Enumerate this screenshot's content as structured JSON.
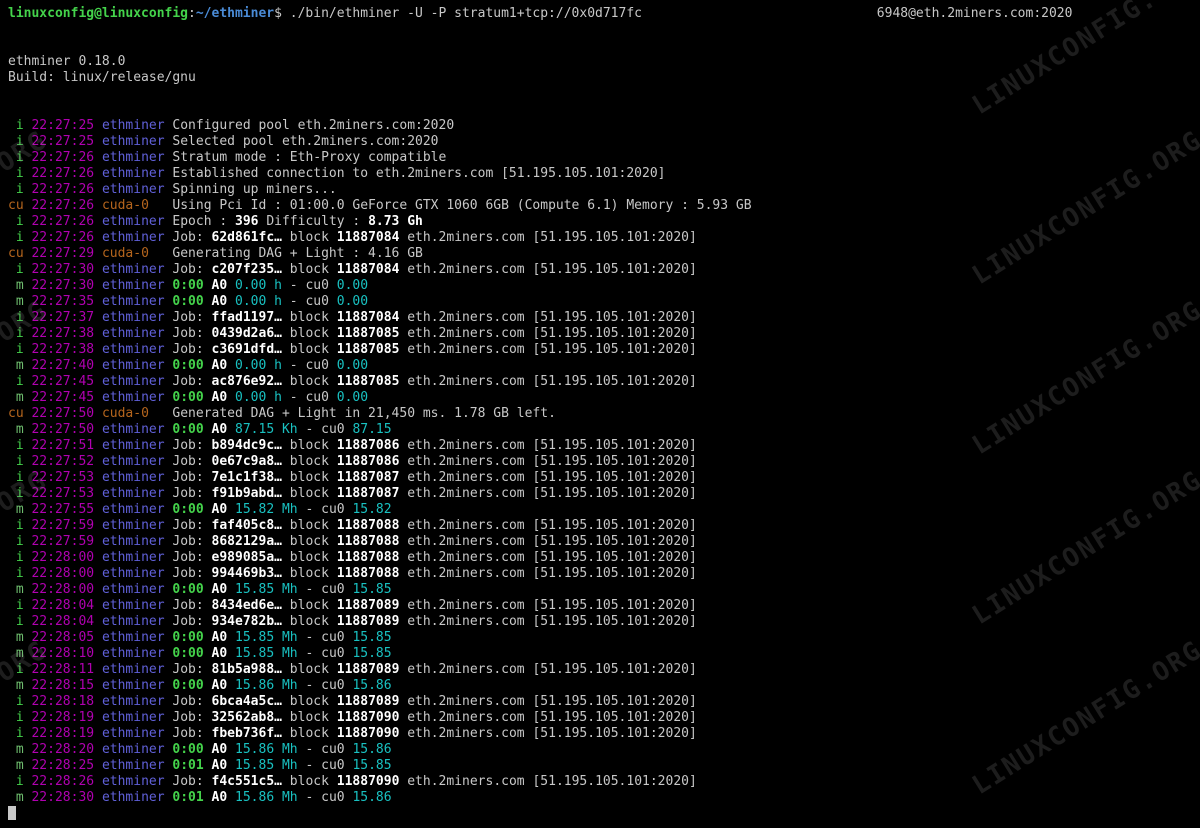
{
  "prompt": {
    "user": "linuxconfig@linuxconfig",
    "path": "~/ethminer",
    "command": "./bin/ethminer -U -P stratum1+tcp://0x0d717fc",
    "command_tail": "6948@eth.2miners.com:2020"
  },
  "header": {
    "line1": "ethminer 0.18.0",
    "line2": "Build: linux/release/gnu"
  },
  "watermark": "LINUXCONFIG.ORG",
  "lines": [
    {
      "tag": " i",
      "ts": "22:27:25",
      "cp": "ethminer",
      "k": "eth",
      "msg": [
        [
          "w",
          "Configured pool eth.2miners.com:2020"
        ]
      ]
    },
    {
      "tag": " i",
      "ts": "22:27:25",
      "cp": "ethminer",
      "k": "eth",
      "msg": [
        [
          "w",
          "Selected pool eth.2miners.com:2020"
        ]
      ]
    },
    {
      "tag": " i",
      "ts": "22:27:26",
      "cp": "ethminer",
      "k": "eth",
      "msg": [
        [
          "w",
          "Stratum mode : Eth-Proxy compatible"
        ]
      ]
    },
    {
      "tag": " i",
      "ts": "22:27:26",
      "cp": "ethminer",
      "k": "eth",
      "msg": [
        [
          "w",
          "Established connection to eth.2miners.com [51.195.105.101:2020]"
        ]
      ]
    },
    {
      "tag": " i",
      "ts": "22:27:26",
      "cp": "ethminer",
      "k": "eth",
      "msg": [
        [
          "w",
          "Spinning up miners..."
        ]
      ]
    },
    {
      "tag": "cu",
      "ts": "22:27:26",
      "cp": "cuda-0  ",
      "k": "cud",
      "msg": [
        [
          "w",
          "Using Pci Id : 01:00.0 GeForce GTX 1060 6GB (Compute 6.1) Memory : 5.93 GB"
        ]
      ]
    },
    {
      "tag": " i",
      "ts": "22:27:26",
      "cp": "ethminer",
      "k": "eth",
      "msg": [
        [
          "w",
          "Epoch : "
        ],
        [
          "bw",
          "396"
        ],
        [
          "w",
          " Difficulty : "
        ],
        [
          "bw",
          "8.73 Gh"
        ]
      ]
    },
    {
      "tag": " i",
      "ts": "22:27:26",
      "cp": "ethminer",
      "k": "eth",
      "msg": [
        [
          "w",
          "Job: "
        ],
        [
          "bw",
          "62d861fc…"
        ],
        [
          "w",
          " block "
        ],
        [
          "bw",
          "11887084"
        ],
        [
          "w",
          " eth.2miners.com [51.195.105.101:2020]"
        ]
      ]
    },
    {
      "tag": "cu",
      "ts": "22:27:29",
      "cp": "cuda-0  ",
      "k": "cud",
      "msg": [
        [
          "w",
          "Generating DAG + Light : 4.16 GB"
        ]
      ]
    },
    {
      "tag": " i",
      "ts": "22:27:30",
      "cp": "ethminer",
      "k": "eth",
      "msg": [
        [
          "w",
          "Job: "
        ],
        [
          "bw",
          "c207f235…"
        ],
        [
          "w",
          " block "
        ],
        [
          "bw",
          "11887084"
        ],
        [
          "w",
          " eth.2miners.com [51.195.105.101:2020]"
        ]
      ]
    },
    {
      "tag": " m",
      "ts": "22:27:30",
      "cp": "ethminer",
      "k": "eth",
      "msg": [
        [
          "bg",
          "0:00"
        ],
        [
          "w",
          " "
        ],
        [
          "bw",
          "A0"
        ],
        [
          "w",
          " "
        ],
        [
          "cy",
          "0.00 h"
        ],
        [
          "w",
          " - cu0 "
        ],
        [
          "cy",
          "0.00"
        ]
      ]
    },
    {
      "tag": " m",
      "ts": "22:27:35",
      "cp": "ethminer",
      "k": "eth",
      "msg": [
        [
          "bg",
          "0:00"
        ],
        [
          "w",
          " "
        ],
        [
          "bw",
          "A0"
        ],
        [
          "w",
          " "
        ],
        [
          "cy",
          "0.00 h"
        ],
        [
          "w",
          " - cu0 "
        ],
        [
          "cy",
          "0.00"
        ]
      ]
    },
    {
      "tag": " i",
      "ts": "22:27:37",
      "cp": "ethminer",
      "k": "eth",
      "msg": [
        [
          "w",
          "Job: "
        ],
        [
          "bw",
          "ffad1197…"
        ],
        [
          "w",
          " block "
        ],
        [
          "bw",
          "11887084"
        ],
        [
          "w",
          " eth.2miners.com [51.195.105.101:2020]"
        ]
      ]
    },
    {
      "tag": " i",
      "ts": "22:27:38",
      "cp": "ethminer",
      "k": "eth",
      "msg": [
        [
          "w",
          "Job: "
        ],
        [
          "bw",
          "0439d2a6…"
        ],
        [
          "w",
          " block "
        ],
        [
          "bw",
          "11887085"
        ],
        [
          "w",
          " eth.2miners.com [51.195.105.101:2020]"
        ]
      ]
    },
    {
      "tag": " i",
      "ts": "22:27:38",
      "cp": "ethminer",
      "k": "eth",
      "msg": [
        [
          "w",
          "Job: "
        ],
        [
          "bw",
          "c3691dfd…"
        ],
        [
          "w",
          " block "
        ],
        [
          "bw",
          "11887085"
        ],
        [
          "w",
          " eth.2miners.com [51.195.105.101:2020]"
        ]
      ]
    },
    {
      "tag": " m",
      "ts": "22:27:40",
      "cp": "ethminer",
      "k": "eth",
      "msg": [
        [
          "bg",
          "0:00"
        ],
        [
          "w",
          " "
        ],
        [
          "bw",
          "A0"
        ],
        [
          "w",
          " "
        ],
        [
          "cy",
          "0.00 h"
        ],
        [
          "w",
          " - cu0 "
        ],
        [
          "cy",
          "0.00"
        ]
      ]
    },
    {
      "tag": " i",
      "ts": "22:27:45",
      "cp": "ethminer",
      "k": "eth",
      "msg": [
        [
          "w",
          "Job: "
        ],
        [
          "bw",
          "ac876e92…"
        ],
        [
          "w",
          " block "
        ],
        [
          "bw",
          "11887085"
        ],
        [
          "w",
          " eth.2miners.com [51.195.105.101:2020]"
        ]
      ]
    },
    {
      "tag": " m",
      "ts": "22:27:45",
      "cp": "ethminer",
      "k": "eth",
      "msg": [
        [
          "bg",
          "0:00"
        ],
        [
          "w",
          " "
        ],
        [
          "bw",
          "A0"
        ],
        [
          "w",
          " "
        ],
        [
          "cy",
          "0.00 h"
        ],
        [
          "w",
          " - cu0 "
        ],
        [
          "cy",
          "0.00"
        ]
      ]
    },
    {
      "tag": "cu",
      "ts": "22:27:50",
      "cp": "cuda-0  ",
      "k": "cud",
      "msg": [
        [
          "w",
          "Generated DAG + Light in 21,450 ms. 1.78 GB left."
        ]
      ]
    },
    {
      "tag": " m",
      "ts": "22:27:50",
      "cp": "ethminer",
      "k": "eth",
      "msg": [
        [
          "bg",
          "0:00"
        ],
        [
          "w",
          " "
        ],
        [
          "bw",
          "A0"
        ],
        [
          "w",
          " "
        ],
        [
          "cy",
          "87.15 Kh"
        ],
        [
          "w",
          " - cu0 "
        ],
        [
          "cy",
          "87.15"
        ]
      ]
    },
    {
      "tag": " i",
      "ts": "22:27:51",
      "cp": "ethminer",
      "k": "eth",
      "msg": [
        [
          "w",
          "Job: "
        ],
        [
          "bw",
          "b894dc9c…"
        ],
        [
          "w",
          " block "
        ],
        [
          "bw",
          "11887086"
        ],
        [
          "w",
          " eth.2miners.com [51.195.105.101:2020]"
        ]
      ]
    },
    {
      "tag": " i",
      "ts": "22:27:52",
      "cp": "ethminer",
      "k": "eth",
      "msg": [
        [
          "w",
          "Job: "
        ],
        [
          "bw",
          "0e67c9a8…"
        ],
        [
          "w",
          " block "
        ],
        [
          "bw",
          "11887086"
        ],
        [
          "w",
          " eth.2miners.com [51.195.105.101:2020]"
        ]
      ]
    },
    {
      "tag": " i",
      "ts": "22:27:53",
      "cp": "ethminer",
      "k": "eth",
      "msg": [
        [
          "w",
          "Job: "
        ],
        [
          "bw",
          "7e1c1f38…"
        ],
        [
          "w",
          " block "
        ],
        [
          "bw",
          "11887087"
        ],
        [
          "w",
          " eth.2miners.com [51.195.105.101:2020]"
        ]
      ]
    },
    {
      "tag": " i",
      "ts": "22:27:53",
      "cp": "ethminer",
      "k": "eth",
      "msg": [
        [
          "w",
          "Job: "
        ],
        [
          "bw",
          "f91b9abd…"
        ],
        [
          "w",
          " block "
        ],
        [
          "bw",
          "11887087"
        ],
        [
          "w",
          " eth.2miners.com [51.195.105.101:2020]"
        ]
      ]
    },
    {
      "tag": " m",
      "ts": "22:27:55",
      "cp": "ethminer",
      "k": "eth",
      "msg": [
        [
          "bg",
          "0:00"
        ],
        [
          "w",
          " "
        ],
        [
          "bw",
          "A0"
        ],
        [
          "w",
          " "
        ],
        [
          "cy",
          "15.82 Mh"
        ],
        [
          "w",
          " - cu0 "
        ],
        [
          "cy",
          "15.82"
        ]
      ]
    },
    {
      "tag": " i",
      "ts": "22:27:59",
      "cp": "ethminer",
      "k": "eth",
      "msg": [
        [
          "w",
          "Job: "
        ],
        [
          "bw",
          "faf405c8…"
        ],
        [
          "w",
          " block "
        ],
        [
          "bw",
          "11887088"
        ],
        [
          "w",
          " eth.2miners.com [51.195.105.101:2020]"
        ]
      ]
    },
    {
      "tag": " i",
      "ts": "22:27:59",
      "cp": "ethminer",
      "k": "eth",
      "msg": [
        [
          "w",
          "Job: "
        ],
        [
          "bw",
          "8682129a…"
        ],
        [
          "w",
          " block "
        ],
        [
          "bw",
          "11887088"
        ],
        [
          "w",
          " eth.2miners.com [51.195.105.101:2020]"
        ]
      ]
    },
    {
      "tag": " i",
      "ts": "22:28:00",
      "cp": "ethminer",
      "k": "eth",
      "msg": [
        [
          "w",
          "Job: "
        ],
        [
          "bw",
          "e989085a…"
        ],
        [
          "w",
          " block "
        ],
        [
          "bw",
          "11887088"
        ],
        [
          "w",
          " eth.2miners.com [51.195.105.101:2020]"
        ]
      ]
    },
    {
      "tag": " i",
      "ts": "22:28:00",
      "cp": "ethminer",
      "k": "eth",
      "msg": [
        [
          "w",
          "Job: "
        ],
        [
          "bw",
          "994469b3…"
        ],
        [
          "w",
          " block "
        ],
        [
          "bw",
          "11887088"
        ],
        [
          "w",
          " eth.2miners.com [51.195.105.101:2020]"
        ]
      ]
    },
    {
      "tag": " m",
      "ts": "22:28:00",
      "cp": "ethminer",
      "k": "eth",
      "msg": [
        [
          "bg",
          "0:00"
        ],
        [
          "w",
          " "
        ],
        [
          "bw",
          "A0"
        ],
        [
          "w",
          " "
        ],
        [
          "cy",
          "15.85 Mh"
        ],
        [
          "w",
          " - cu0 "
        ],
        [
          "cy",
          "15.85"
        ]
      ]
    },
    {
      "tag": " i",
      "ts": "22:28:04",
      "cp": "ethminer",
      "k": "eth",
      "msg": [
        [
          "w",
          "Job: "
        ],
        [
          "bw",
          "8434ed6e…"
        ],
        [
          "w",
          " block "
        ],
        [
          "bw",
          "11887089"
        ],
        [
          "w",
          " eth.2miners.com [51.195.105.101:2020]"
        ]
      ]
    },
    {
      "tag": " i",
      "ts": "22:28:04",
      "cp": "ethminer",
      "k": "eth",
      "msg": [
        [
          "w",
          "Job: "
        ],
        [
          "bw",
          "934e782b…"
        ],
        [
          "w",
          " block "
        ],
        [
          "bw",
          "11887089"
        ],
        [
          "w",
          " eth.2miners.com [51.195.105.101:2020]"
        ]
      ]
    },
    {
      "tag": " m",
      "ts": "22:28:05",
      "cp": "ethminer",
      "k": "eth",
      "msg": [
        [
          "bg",
          "0:00"
        ],
        [
          "w",
          " "
        ],
        [
          "bw",
          "A0"
        ],
        [
          "w",
          " "
        ],
        [
          "cy",
          "15.85 Mh"
        ],
        [
          "w",
          " - cu0 "
        ],
        [
          "cy",
          "15.85"
        ]
      ]
    },
    {
      "tag": " m",
      "ts": "22:28:10",
      "cp": "ethminer",
      "k": "eth",
      "msg": [
        [
          "bg",
          "0:00"
        ],
        [
          "w",
          " "
        ],
        [
          "bw",
          "A0"
        ],
        [
          "w",
          " "
        ],
        [
          "cy",
          "15.85 Mh"
        ],
        [
          "w",
          " - cu0 "
        ],
        [
          "cy",
          "15.85"
        ]
      ]
    },
    {
      "tag": " i",
      "ts": "22:28:11",
      "cp": "ethminer",
      "k": "eth",
      "msg": [
        [
          "w",
          "Job: "
        ],
        [
          "bw",
          "81b5a988…"
        ],
        [
          "w",
          " block "
        ],
        [
          "bw",
          "11887089"
        ],
        [
          "w",
          " eth.2miners.com [51.195.105.101:2020]"
        ]
      ]
    },
    {
      "tag": " m",
      "ts": "22:28:15",
      "cp": "ethminer",
      "k": "eth",
      "msg": [
        [
          "bg",
          "0:00"
        ],
        [
          "w",
          " "
        ],
        [
          "bw",
          "A0"
        ],
        [
          "w",
          " "
        ],
        [
          "cy",
          "15.86 Mh"
        ],
        [
          "w",
          " - cu0 "
        ],
        [
          "cy",
          "15.86"
        ]
      ]
    },
    {
      "tag": " i",
      "ts": "22:28:18",
      "cp": "ethminer",
      "k": "eth",
      "msg": [
        [
          "w",
          "Job: "
        ],
        [
          "bw",
          "6bca4a5c…"
        ],
        [
          "w",
          " block "
        ],
        [
          "bw",
          "11887089"
        ],
        [
          "w",
          " eth.2miners.com [51.195.105.101:2020]"
        ]
      ]
    },
    {
      "tag": " i",
      "ts": "22:28:19",
      "cp": "ethminer",
      "k": "eth",
      "msg": [
        [
          "w",
          "Job: "
        ],
        [
          "bw",
          "32562ab8…"
        ],
        [
          "w",
          " block "
        ],
        [
          "bw",
          "11887090"
        ],
        [
          "w",
          " eth.2miners.com [51.195.105.101:2020]"
        ]
      ]
    },
    {
      "tag": " i",
      "ts": "22:28:19",
      "cp": "ethminer",
      "k": "eth",
      "msg": [
        [
          "w",
          "Job: "
        ],
        [
          "bw",
          "fbeb736f…"
        ],
        [
          "w",
          " block "
        ],
        [
          "bw",
          "11887090"
        ],
        [
          "w",
          " eth.2miners.com [51.195.105.101:2020]"
        ]
      ]
    },
    {
      "tag": " m",
      "ts": "22:28:20",
      "cp": "ethminer",
      "k": "eth",
      "msg": [
        [
          "bg",
          "0:00"
        ],
        [
          "w",
          " "
        ],
        [
          "bw",
          "A0"
        ],
        [
          "w",
          " "
        ],
        [
          "cy",
          "15.86 Mh"
        ],
        [
          "w",
          " - cu0 "
        ],
        [
          "cy",
          "15.86"
        ]
      ]
    },
    {
      "tag": " m",
      "ts": "22:28:25",
      "cp": "ethminer",
      "k": "eth",
      "msg": [
        [
          "bg",
          "0:01"
        ],
        [
          "w",
          " "
        ],
        [
          "bw",
          "A0"
        ],
        [
          "w",
          " "
        ],
        [
          "cy",
          "15.85 Mh"
        ],
        [
          "w",
          " - cu0 "
        ],
        [
          "cy",
          "15.85"
        ]
      ]
    },
    {
      "tag": " i",
      "ts": "22:28:26",
      "cp": "ethminer",
      "k": "eth",
      "msg": [
        [
          "w",
          "Job: "
        ],
        [
          "bw",
          "f4c551c5…"
        ],
        [
          "w",
          " block "
        ],
        [
          "bw",
          "11887090"
        ],
        [
          "w",
          " eth.2miners.com [51.195.105.101:2020]"
        ]
      ]
    },
    {
      "tag": " m",
      "ts": "22:28:30",
      "cp": "ethminer",
      "k": "eth",
      "msg": [
        [
          "bg",
          "0:01"
        ],
        [
          "w",
          " "
        ],
        [
          "bw",
          "A0"
        ],
        [
          "w",
          " "
        ],
        [
          "cy",
          "15.86 Mh"
        ],
        [
          "w",
          " - cu0 "
        ],
        [
          "cy",
          "15.86"
        ]
      ]
    }
  ]
}
